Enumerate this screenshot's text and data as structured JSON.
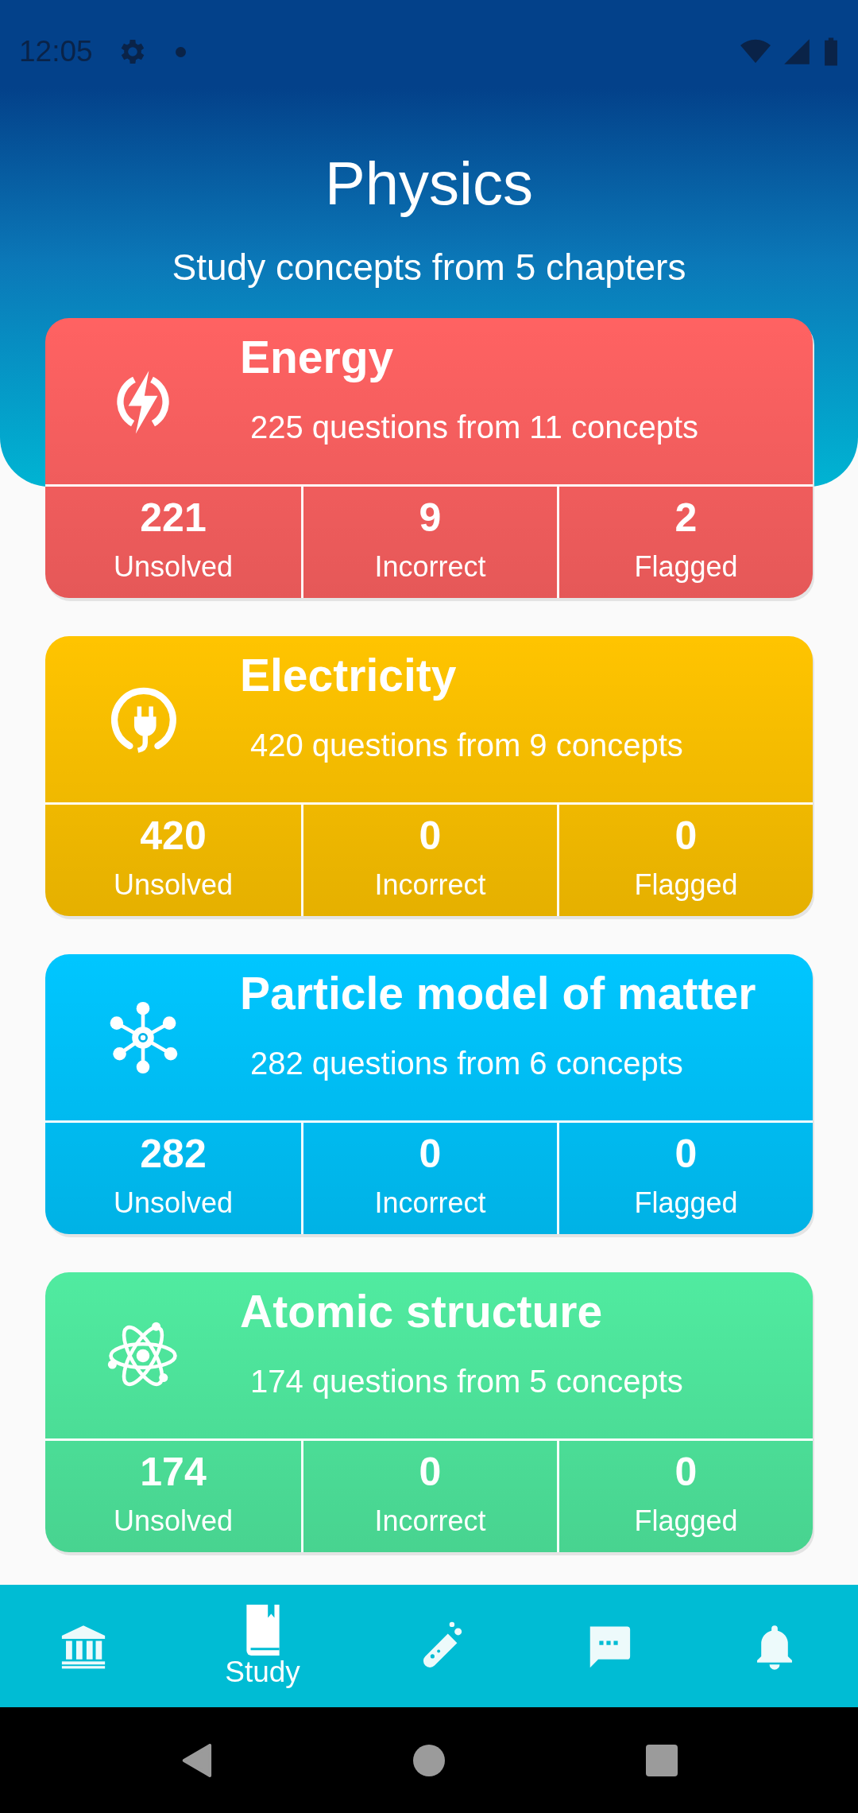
{
  "status_bar": {
    "time": "12:05"
  },
  "header": {
    "title": "Physics",
    "subtitle": "Study concepts from 5 chapters"
  },
  "chapters": [
    {
      "title": "Energy",
      "subtitle": "225 questions from 11 concepts",
      "color": "#ff6262",
      "stats": [
        {
          "value": "221",
          "label": "Unsolved"
        },
        {
          "value": "9",
          "label": "Incorrect"
        },
        {
          "value": "2",
          "label": "Flagged"
        }
      ]
    },
    {
      "title": "Electricity",
      "subtitle": "420 questions from 9 concepts",
      "color": "#ffc400",
      "stats": [
        {
          "value": "420",
          "label": "Unsolved"
        },
        {
          "value": "0",
          "label": "Incorrect"
        },
        {
          "value": "0",
          "label": "Flagged"
        }
      ]
    },
    {
      "title": "Particle model of matter",
      "subtitle": "282 questions from 6 concepts",
      "color": "#00c6ff",
      "stats": [
        {
          "value": "282",
          "label": "Unsolved"
        },
        {
          "value": "0",
          "label": "Incorrect"
        },
        {
          "value": "0",
          "label": "Flagged"
        }
      ]
    },
    {
      "title": "Atomic structure",
      "subtitle": "174 questions from 5 concepts",
      "color": "#50eba0",
      "stats": [
        {
          "value": "174",
          "label": "Unsolved"
        },
        {
          "value": "0",
          "label": "Incorrect"
        },
        {
          "value": "0",
          "label": "Flagged"
        }
      ]
    }
  ],
  "bottom_nav": [
    {
      "selected": false
    },
    {
      "label": "Study",
      "selected": true
    },
    {
      "selected": false
    },
    {
      "selected": false
    },
    {
      "selected": false
    }
  ]
}
